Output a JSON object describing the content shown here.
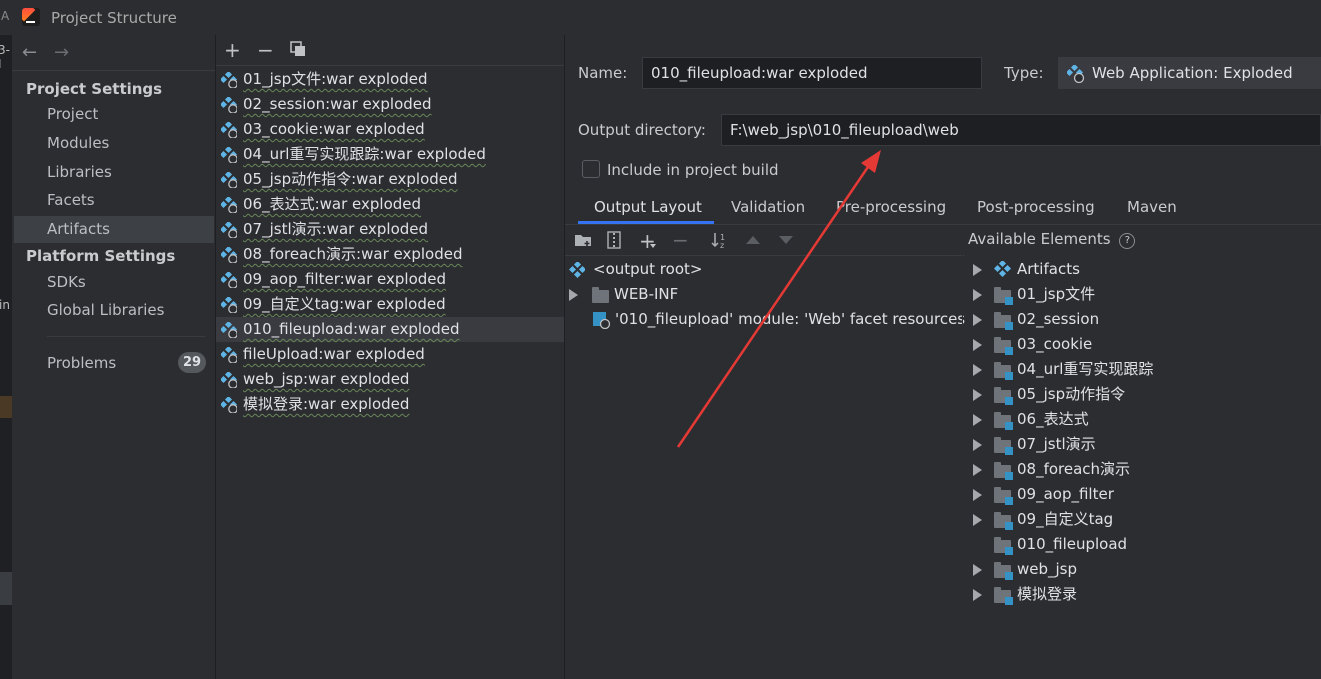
{
  "window": {
    "title": "Project Structure",
    "left_strip_labels": [
      "A",
      "3-I",
      "in"
    ]
  },
  "nav": {
    "back_icon": "arrow-left-icon",
    "forward_icon": "arrow-right-icon"
  },
  "sidebar": {
    "project_settings_header": "Project Settings",
    "project_items": [
      "Project",
      "Modules",
      "Libraries",
      "Facets",
      "Artifacts"
    ],
    "platform_settings_header": "Platform Settings",
    "platform_items": [
      "SDKs",
      "Global Libraries"
    ],
    "problems_label": "Problems",
    "problems_count": "29",
    "selected": "Artifacts"
  },
  "list_toolbar": {
    "add": "+",
    "remove": "−",
    "copy_icon": "copy-icon"
  },
  "artifacts": [
    "01_jsp文件:war exploded",
    "02_session:war exploded",
    "03_cookie:war exploded",
    "04_url重写实现跟踪:war exploded",
    "05_jsp动作指令:war exploded",
    "06_表达式:war exploded",
    "07_jstl演示:war exploded",
    "08_foreach演示:war exploded",
    "09_aop_filter:war exploded",
    "09_自定义tag:war exploded",
    "010_fileupload:war exploded",
    "fileUpload:war exploded",
    "web_jsp:war exploded",
    "模拟登录:war exploded"
  ],
  "selected_artifact": "010_fileupload:war exploded",
  "details": {
    "name_label": "Name:",
    "name_value": "010_fileupload:war exploded",
    "type_label": "Type:",
    "type_value": "Web Application: Exploded",
    "output_dir_label": "Output directory:",
    "output_dir_value": "F:\\web_jsp\\010_fileupload\\web",
    "include_label": "Include in project build",
    "include_checked": false
  },
  "tabs": [
    "Output Layout",
    "Validation",
    "Pre-processing",
    "Post-processing",
    "Maven"
  ],
  "active_tab": "Output Layout",
  "layout_toolbar": {
    "icons": [
      "new-folder-icon",
      "archive-icon",
      "add-icon",
      "remove-icon",
      "sort-icon",
      "move-up-icon",
      "move-down-icon"
    ]
  },
  "output_tree": [
    {
      "label": "<output root>",
      "icon": "artifact-icon",
      "expandable": false
    },
    {
      "label": "WEB-INF",
      "icon": "folder-icon",
      "expandable": true
    },
    {
      "label": "'010_fileupload' module: 'Web' facet resources",
      "icon": "web-facet-icon",
      "expandable": false
    }
  ],
  "available": {
    "header": "Available Elements",
    "help_icon": "help-icon",
    "items": [
      {
        "label": "Artifacts",
        "icon": "artifact-icon",
        "expandable": true
      },
      {
        "label": "01_jsp文件",
        "icon": "module-folder-icon",
        "expandable": true
      },
      {
        "label": "02_session",
        "icon": "module-folder-icon",
        "expandable": true
      },
      {
        "label": "03_cookie",
        "icon": "module-folder-icon",
        "expandable": true
      },
      {
        "label": "04_url重写实现跟踪",
        "icon": "module-folder-icon",
        "expandable": true
      },
      {
        "label": "05_jsp动作指令",
        "icon": "module-folder-icon",
        "expandable": true
      },
      {
        "label": "06_表达式",
        "icon": "module-folder-icon",
        "expandable": true
      },
      {
        "label": "07_jstl演示",
        "icon": "module-folder-icon",
        "expandable": true
      },
      {
        "label": "08_foreach演示",
        "icon": "module-folder-icon",
        "expandable": true
      },
      {
        "label": "09_aop_filter",
        "icon": "module-folder-icon",
        "expandable": true
      },
      {
        "label": "09_自定义tag",
        "icon": "module-folder-icon",
        "expandable": true
      },
      {
        "label": "010_fileupload",
        "icon": "module-folder-icon",
        "expandable": false
      },
      {
        "label": "web_jsp",
        "icon": "module-folder-icon",
        "expandable": true
      },
      {
        "label": "模拟登录",
        "icon": "module-folder-icon",
        "expandable": true
      }
    ]
  },
  "annotation": {
    "arrow_color": "#e53935"
  },
  "colors": {
    "background": "#2b2d30",
    "selection": "#393b40",
    "accent": "#3574f0",
    "artifact_icon": "#5fb4e6"
  }
}
